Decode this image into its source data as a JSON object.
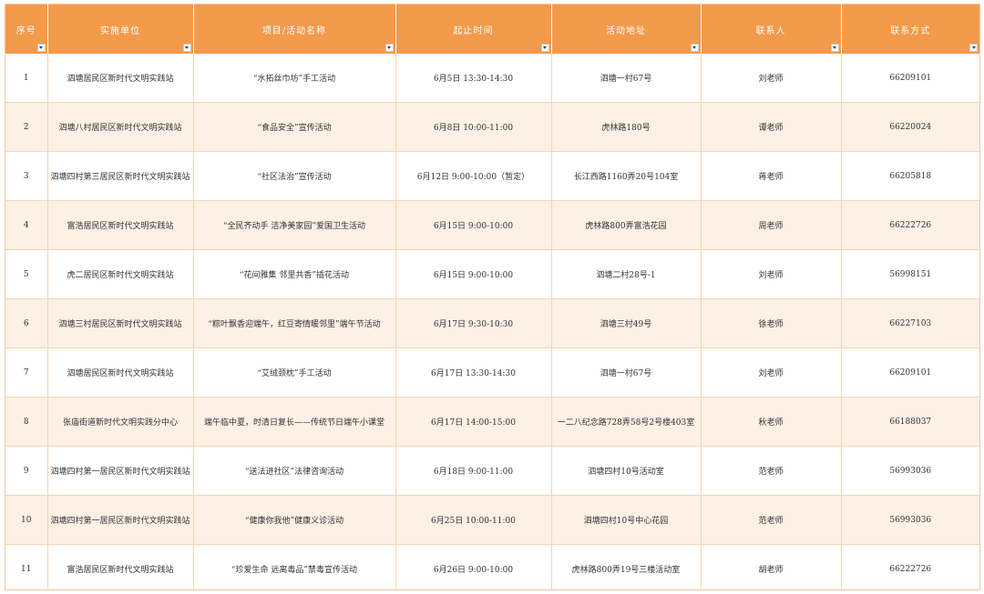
{
  "table": {
    "headers": [
      "序号",
      "实施单位",
      "项目/活动名称",
      "起止时间",
      "活动地址",
      "联系人",
      "联系方式"
    ],
    "rows": [
      [
        "1",
        "泗塘居民区新时代文明实践站",
        "“水拓丝巾坊”手工活动",
        "6月5日  13:30-14:30",
        "泗塘一村67号",
        "刘老师",
        "66209101"
      ],
      [
        "2",
        "泗塘八村居民区新时代文明实践站",
        "“食品安全”宣传活动",
        "6月8日  10:00-11:00",
        "虎林路180号",
        "谭老师",
        "66220024"
      ],
      [
        "3",
        "泗塘四村第三居民区新时代文明实践站",
        "“社区法治”宣传活动",
        "6月12日  9:00-10:00（暂定）",
        "长江西路1160弄20号104室",
        "蒋老师",
        "66205818"
      ],
      [
        "4",
        "富浩居民区新时代文明实践站",
        "“全民齐动手 洁净美家园”爱国卫生活动",
        "6月15日  9:00-10:00",
        "虎林路800弄富浩花园",
        "周老师",
        "66222726"
      ],
      [
        "5",
        "虎二居民区新时代文明实践站",
        "“花间雅集 邻里共香”插花活动",
        "6月15日  9:00-10:00",
        "泗塘二村28号-1",
        "刘老师",
        "56998151"
      ],
      [
        "6",
        "泗塘三村居民区新时代文明实践站",
        "“粽叶飘香迎端午，红豆寄情暖邻里”端午节活动",
        "6月17日  9:30-10:30",
        "泗塘三村49号",
        "徐老师",
        "66227103"
      ],
      [
        "7",
        "泗塘居民区新时代文明实践站",
        "“艾绒颈枕”手工活动",
        "6月17日  13:30-14:30",
        "泗塘一村67号",
        "刘老师",
        "66209101"
      ],
      [
        "8",
        "张庙街道新时代文明实践分中心",
        "端午临中夏，时清日复长——传统节日端午小课堂",
        "6月17日  14:00-15:00",
        "一二八纪念路728弄58号2号楼403室",
        "秋老师",
        "66188037"
      ],
      [
        "9",
        "泗塘四村第一居民区新时代文明实践站",
        "“送法进社区”法律咨询活动",
        "6月18日  9:00-11:00",
        "泗塘四村10号活动室",
        "范老师",
        "56993036"
      ],
      [
        "10",
        "泗塘四村第一居民区新时代文明实践站",
        "“健康你我他”健康义诊活动",
        "6月25日  10:00-11:00",
        "泗塘四村10号中心花园",
        "范老师",
        "56993036"
      ],
      [
        "11",
        "富浩居民区新时代文明实践站",
        "“珍爱生命 远离毒品”禁毒宣传活动",
        "6月26日  9:00-10:00",
        "虎林路800弄19号三楼活动室",
        "胡老师",
        "66222726"
      ]
    ]
  },
  "colors": {
    "header_bg": "#f39a4b",
    "header_text": "#ffffff",
    "row_alt_bg": "#fdf0e5",
    "grid_line": "#f6d4b6"
  },
  "icons": {
    "filter": "chevron-down-icon"
  }
}
